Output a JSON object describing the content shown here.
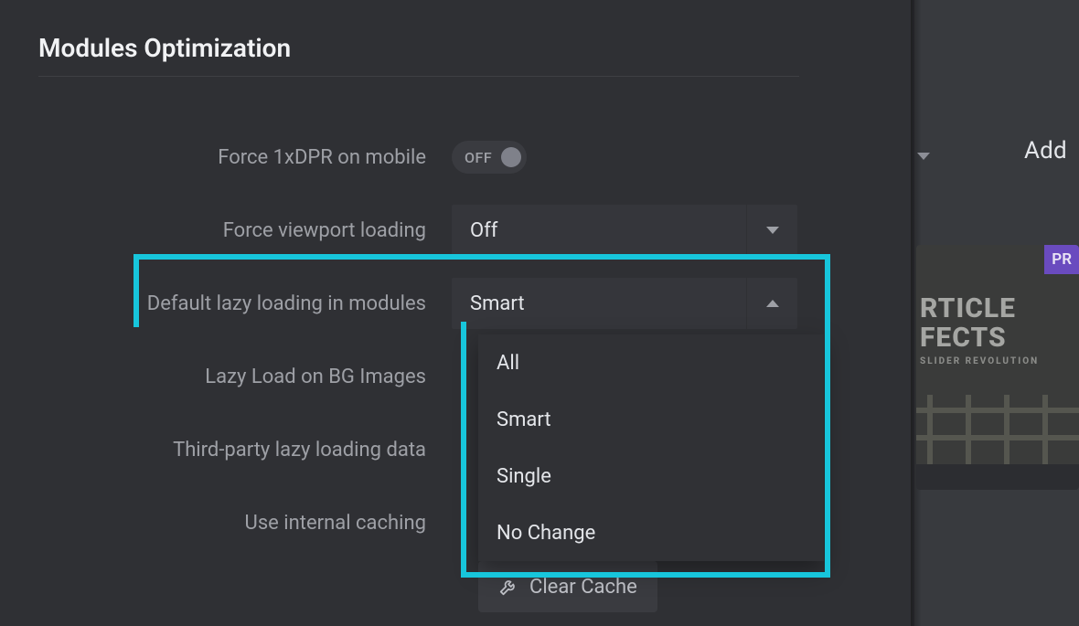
{
  "panel": {
    "title": "Modules Optimization"
  },
  "backdrop": {
    "add_label": "Add",
    "card": {
      "badge": "PR",
      "title_l1": "RTICLE",
      "title_l2": "FECTS",
      "subtitle": "SLIDER REVOLUTION"
    }
  },
  "rows": {
    "force_dpr": {
      "label": "Force 1xDPR on mobile",
      "toggle_text": "OFF"
    },
    "viewport": {
      "label": "Force viewport loading",
      "value": "Off"
    },
    "lazy": {
      "label": "Default lazy loading in modules",
      "value": "Smart"
    },
    "bg": {
      "label": "Lazy Load on BG Images"
    },
    "thirdparty": {
      "label": "Third-party lazy loading data"
    },
    "cache": {
      "label": "Use internal caching"
    }
  },
  "menu": {
    "items": [
      "All",
      "Smart",
      "Single",
      "No Change"
    ]
  },
  "buttons": {
    "clear_cache": "Clear Cache"
  }
}
